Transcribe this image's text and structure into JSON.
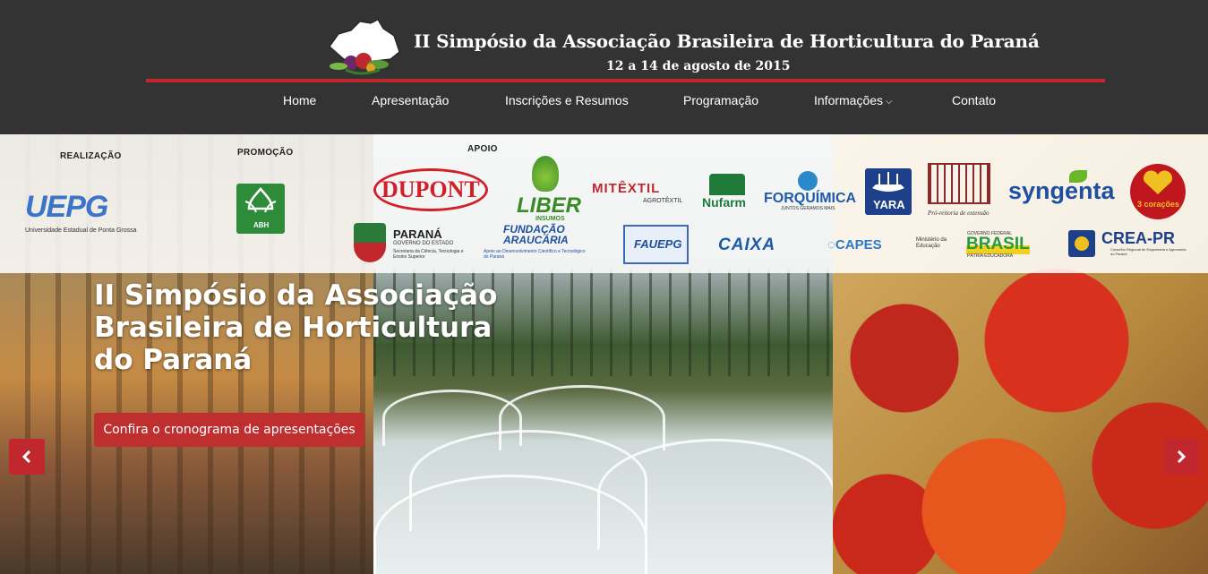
{
  "header": {
    "title": "II Simpósio da Associação Brasileira de Horticultura do Paraná",
    "subtitle": "12 a 14 de agosto de 2015"
  },
  "nav": {
    "items": [
      {
        "label": "Home"
      },
      {
        "label": "Apresentação"
      },
      {
        "label": "Inscrições e Resumos"
      },
      {
        "label": "Programação"
      },
      {
        "label": "Informações"
      },
      {
        "label": "Contato"
      }
    ]
  },
  "sponsors": {
    "realizacao_label": "REALIZAÇÃO",
    "promocao_label": "PROMOÇÃO",
    "apoio_label": "APOIO",
    "uepg": {
      "name": "UEPG",
      "caption": "Universidade Estadual de Ponta Grossa"
    },
    "abh": {
      "name": "ABH"
    },
    "apoio": [
      {
        "name": "DUPONT"
      },
      {
        "name": "LIBER",
        "caption": "INSUMOS"
      },
      {
        "name": "MITÊXTIL",
        "caption": "AGROTÊXTIL"
      },
      {
        "name": "Nufarm"
      },
      {
        "name": "FORQUÍMICA",
        "caption": "JUNTOS GERAMOS MAIS"
      },
      {
        "name": "YARA"
      },
      {
        "name": "Pró-reitoria de extensão"
      },
      {
        "name": "syngenta"
      },
      {
        "name": "3 corações"
      },
      {
        "name": "PARANÁ",
        "caption": "GOVERNO DO ESTADO"
      },
      {
        "name": "Secretaria da Ciência, Tecnologia e Ensino Superior"
      },
      {
        "name": "FUNDAÇÃO ARAUCÁRIA",
        "caption": "Apoio ao Desenvolvimento Científico e Tecnológico do Paraná"
      },
      {
        "name": "FAUEPG"
      },
      {
        "name": "CAIXA"
      },
      {
        "name": "CAPES"
      },
      {
        "name": "Ministério da Educação"
      },
      {
        "name": "BRASIL",
        "caption": "GOVERNO FEDERAL",
        "motto": "PÁTRIA EDUCADORA"
      },
      {
        "name": "CREA-PR",
        "caption": "Conselho Regional de Engenharia e Agronomia do Paraná"
      }
    ]
  },
  "hero": {
    "title": "II Simpósio da Associação Brasileira de Horticultura do Paraná",
    "cta_label": "Confira o cronograma de apresentações"
  },
  "colors": {
    "header_bg": "#333333",
    "accent_red": "#c0282e"
  },
  "icons": {
    "prev": "chevron-left-icon",
    "next": "chevron-right-icon",
    "dropdown": "chevron-down-icon"
  }
}
